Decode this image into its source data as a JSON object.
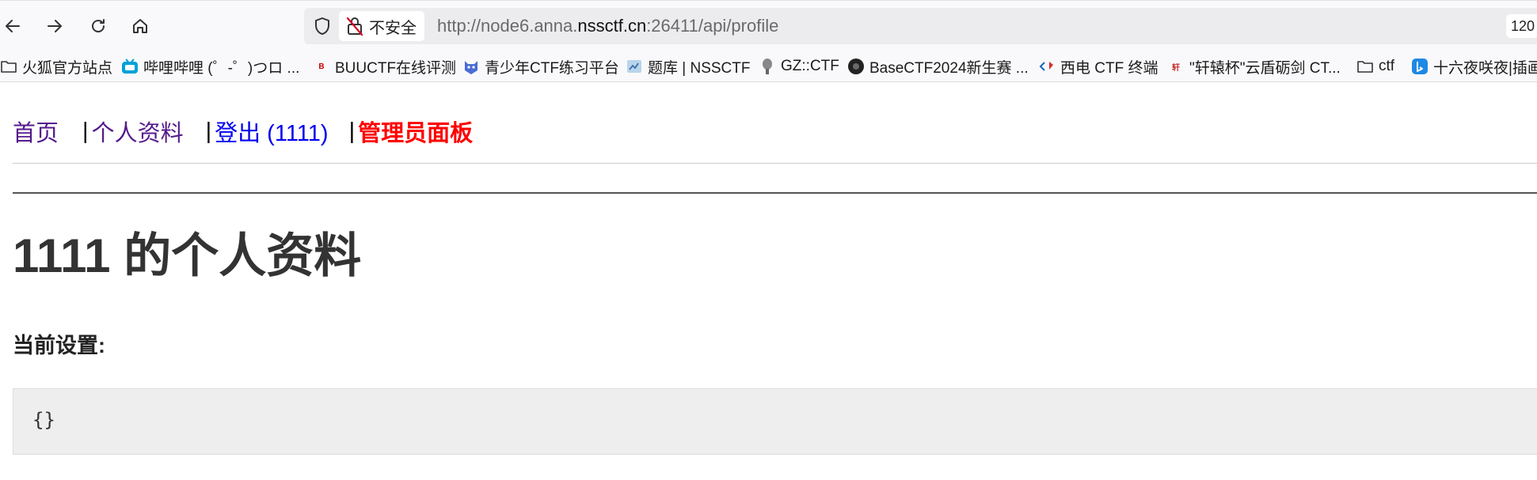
{
  "browser": {
    "url_prefix": "http://node6.anna.",
    "url_host": "nssctf.cn",
    "url_suffix": ":26411/api/profile",
    "security_label": "不安全",
    "zoom": "120"
  },
  "bookmarks": [
    {
      "label": "火狐官方站点",
      "icon": "folder-icon"
    },
    {
      "label": "哔哩哔哩 (゜-゜)つロ ...",
      "icon": "bilibili-icon"
    },
    {
      "label": "BUUCTF在线评测",
      "icon": "buuctf-icon"
    },
    {
      "label": "青少年CTF练习平台",
      "icon": "qsnctf-icon"
    },
    {
      "label": "题库 | NSSCTF",
      "icon": "nssctf-icon"
    },
    {
      "label": "GZ::CTF",
      "icon": "gzctf-icon"
    },
    {
      "label": "BaseCTF2024新生赛 ...",
      "icon": "basectf-icon"
    },
    {
      "label": "西电 CTF 终端",
      "icon": "xidian-icon"
    },
    {
      "label": "\"轩辕杯\"云盾砺剑 CT...",
      "icon": "xuanyuan-icon"
    },
    {
      "label": "ctf",
      "icon": "folder-icon"
    },
    {
      "label": "十六夜咲夜|插画",
      "icon": "bing-icon"
    }
  ],
  "site_nav": {
    "home": "首页",
    "profile": "个人资料",
    "logout": "登出 (1111)",
    "admin": "管理员面板",
    "separator": "|"
  },
  "profile": {
    "title": "1111 的个人资料",
    "settings_label": "当前设置:",
    "settings_value": "{}"
  },
  "colors": {
    "visited_link": "#551a8b",
    "link": "#0000ee",
    "admin_link": "#ff0000",
    "code_bg": "#eeeeee"
  }
}
